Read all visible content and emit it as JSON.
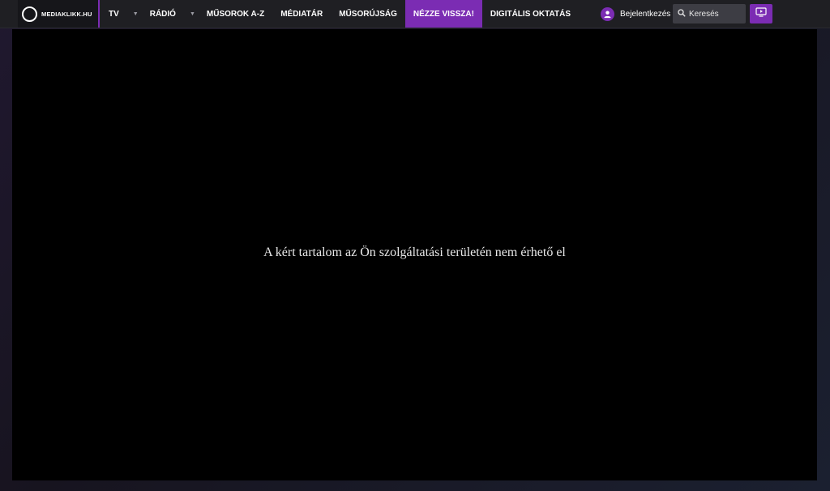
{
  "header": {
    "logo_text": "MEDIAKLIKK.HU",
    "nav": [
      {
        "label": "TV",
        "has_dropdown": true
      },
      {
        "label": "RÁDIÓ",
        "has_dropdown": true
      },
      {
        "label": "MŰSOROK A-Z",
        "has_dropdown": false
      },
      {
        "label": "MÉDIATÁR",
        "has_dropdown": false
      },
      {
        "label": "MŰSORÚJSÁG",
        "has_dropdown": false
      },
      {
        "label": "NÉZZE VISSZA!",
        "has_dropdown": false,
        "active": true
      },
      {
        "label": "DIGITÁLIS OKTATÁS",
        "has_dropdown": false
      }
    ],
    "login_label": "Bejelentkezés",
    "search": {
      "placeholder": "Keresés",
      "value": ""
    },
    "accent_color": "#7b2cb3"
  },
  "icons": {
    "logo": "circle-logo-icon",
    "caret": "caret-down-icon",
    "user": "user-icon",
    "search": "search-icon",
    "tv": "tv-play-icon"
  },
  "player": {
    "message": "A kért tartalom az Ön szolgáltatási területén nem érhető el"
  }
}
